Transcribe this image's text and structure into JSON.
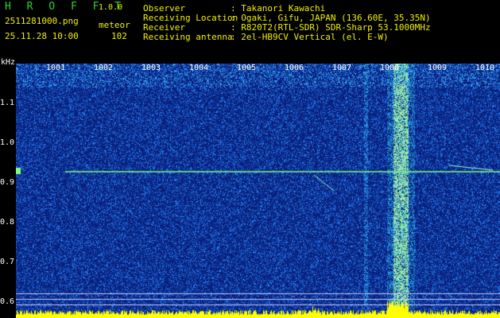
{
  "header": {
    "app_name": "H R O F F T",
    "version": "1.0.0",
    "filename": "2511281000.png",
    "mode": "meteor",
    "datetime": "25.11.28 10:00",
    "count": "102",
    "fields": [
      {
        "label": "Observer",
        "value": ": Takanori Kawachi"
      },
      {
        "label": "Receiving Location",
        "value": ": Ogaki, Gifu, JAPAN (136.60E, 35.35N)"
      },
      {
        "label": "Receiver",
        "value": ": R820T2(RTL-SDR) SDR-Sharp 53.1000MHz"
      },
      {
        "label": "Receiving antenna",
        "value": ": 2el-HB9CV Vertical (el. E-W)"
      }
    ]
  },
  "axes": {
    "y_unit": "kHz",
    "y_ticks": [
      "1.1",
      "1.0",
      "0.9",
      "0.8",
      "0.7",
      "0.6"
    ],
    "x_ticks": [
      "1001",
      "1002",
      "1003",
      "1004",
      "1005",
      "1006",
      "1007",
      "1008",
      "1009",
      "1010"
    ]
  },
  "colors": {
    "background": "#0a1e78",
    "noise": "#4aa0ff",
    "signal": "#7fff7f",
    "level_bar": "#ffff00"
  }
}
